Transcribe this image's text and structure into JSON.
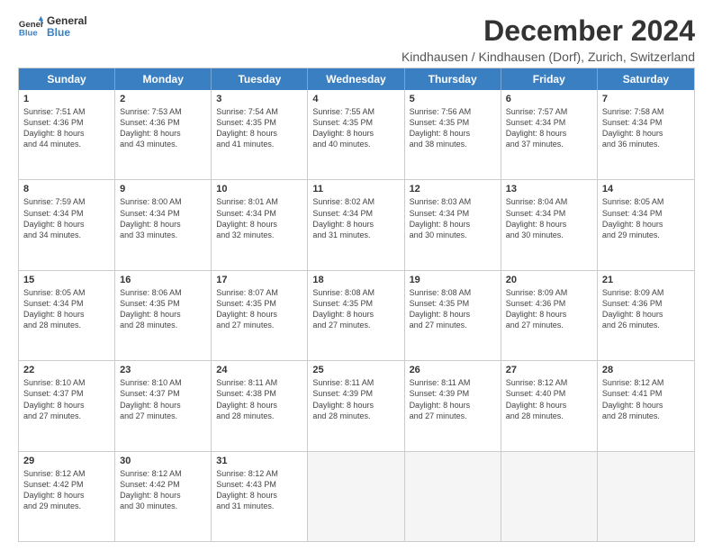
{
  "logo": {
    "line1": "General",
    "line2": "Blue"
  },
  "title": "December 2024",
  "subtitle": "Kindhausen / Kindhausen (Dorf), Zurich, Switzerland",
  "days_of_week": [
    "Sunday",
    "Monday",
    "Tuesday",
    "Wednesday",
    "Thursday",
    "Friday",
    "Saturday"
  ],
  "weeks": [
    [
      {
        "day": "1",
        "lines": [
          "Sunrise: 7:51 AM",
          "Sunset: 4:36 PM",
          "Daylight: 8 hours",
          "and 44 minutes."
        ]
      },
      {
        "day": "2",
        "lines": [
          "Sunrise: 7:53 AM",
          "Sunset: 4:36 PM",
          "Daylight: 8 hours",
          "and 43 minutes."
        ]
      },
      {
        "day": "3",
        "lines": [
          "Sunrise: 7:54 AM",
          "Sunset: 4:35 PM",
          "Daylight: 8 hours",
          "and 41 minutes."
        ]
      },
      {
        "day": "4",
        "lines": [
          "Sunrise: 7:55 AM",
          "Sunset: 4:35 PM",
          "Daylight: 8 hours",
          "and 40 minutes."
        ]
      },
      {
        "day": "5",
        "lines": [
          "Sunrise: 7:56 AM",
          "Sunset: 4:35 PM",
          "Daylight: 8 hours",
          "and 38 minutes."
        ]
      },
      {
        "day": "6",
        "lines": [
          "Sunrise: 7:57 AM",
          "Sunset: 4:34 PM",
          "Daylight: 8 hours",
          "and 37 minutes."
        ]
      },
      {
        "day": "7",
        "lines": [
          "Sunrise: 7:58 AM",
          "Sunset: 4:34 PM",
          "Daylight: 8 hours",
          "and 36 minutes."
        ]
      }
    ],
    [
      {
        "day": "8",
        "lines": [
          "Sunrise: 7:59 AM",
          "Sunset: 4:34 PM",
          "Daylight: 8 hours",
          "and 34 minutes."
        ]
      },
      {
        "day": "9",
        "lines": [
          "Sunrise: 8:00 AM",
          "Sunset: 4:34 PM",
          "Daylight: 8 hours",
          "and 33 minutes."
        ]
      },
      {
        "day": "10",
        "lines": [
          "Sunrise: 8:01 AM",
          "Sunset: 4:34 PM",
          "Daylight: 8 hours",
          "and 32 minutes."
        ]
      },
      {
        "day": "11",
        "lines": [
          "Sunrise: 8:02 AM",
          "Sunset: 4:34 PM",
          "Daylight: 8 hours",
          "and 31 minutes."
        ]
      },
      {
        "day": "12",
        "lines": [
          "Sunrise: 8:03 AM",
          "Sunset: 4:34 PM",
          "Daylight: 8 hours",
          "and 30 minutes."
        ]
      },
      {
        "day": "13",
        "lines": [
          "Sunrise: 8:04 AM",
          "Sunset: 4:34 PM",
          "Daylight: 8 hours",
          "and 30 minutes."
        ]
      },
      {
        "day": "14",
        "lines": [
          "Sunrise: 8:05 AM",
          "Sunset: 4:34 PM",
          "Daylight: 8 hours",
          "and 29 minutes."
        ]
      }
    ],
    [
      {
        "day": "15",
        "lines": [
          "Sunrise: 8:05 AM",
          "Sunset: 4:34 PM",
          "Daylight: 8 hours",
          "and 28 minutes."
        ]
      },
      {
        "day": "16",
        "lines": [
          "Sunrise: 8:06 AM",
          "Sunset: 4:35 PM",
          "Daylight: 8 hours",
          "and 28 minutes."
        ]
      },
      {
        "day": "17",
        "lines": [
          "Sunrise: 8:07 AM",
          "Sunset: 4:35 PM",
          "Daylight: 8 hours",
          "and 27 minutes."
        ]
      },
      {
        "day": "18",
        "lines": [
          "Sunrise: 8:08 AM",
          "Sunset: 4:35 PM",
          "Daylight: 8 hours",
          "and 27 minutes."
        ]
      },
      {
        "day": "19",
        "lines": [
          "Sunrise: 8:08 AM",
          "Sunset: 4:35 PM",
          "Daylight: 8 hours",
          "and 27 minutes."
        ]
      },
      {
        "day": "20",
        "lines": [
          "Sunrise: 8:09 AM",
          "Sunset: 4:36 PM",
          "Daylight: 8 hours",
          "and 27 minutes."
        ]
      },
      {
        "day": "21",
        "lines": [
          "Sunrise: 8:09 AM",
          "Sunset: 4:36 PM",
          "Daylight: 8 hours",
          "and 26 minutes."
        ]
      }
    ],
    [
      {
        "day": "22",
        "lines": [
          "Sunrise: 8:10 AM",
          "Sunset: 4:37 PM",
          "Daylight: 8 hours",
          "and 27 minutes."
        ]
      },
      {
        "day": "23",
        "lines": [
          "Sunrise: 8:10 AM",
          "Sunset: 4:37 PM",
          "Daylight: 8 hours",
          "and 27 minutes."
        ]
      },
      {
        "day": "24",
        "lines": [
          "Sunrise: 8:11 AM",
          "Sunset: 4:38 PM",
          "Daylight: 8 hours",
          "and 28 minutes."
        ]
      },
      {
        "day": "25",
        "lines": [
          "Sunrise: 8:11 AM",
          "Sunset: 4:39 PM",
          "Daylight: 8 hours",
          "and 28 minutes."
        ]
      },
      {
        "day": "26",
        "lines": [
          "Sunrise: 8:11 AM",
          "Sunset: 4:39 PM",
          "Daylight: 8 hours",
          "and 27 minutes."
        ]
      },
      {
        "day": "27",
        "lines": [
          "Sunrise: 8:12 AM",
          "Sunset: 4:40 PM",
          "Daylight: 8 hours",
          "and 28 minutes."
        ]
      },
      {
        "day": "28",
        "lines": [
          "Sunrise: 8:12 AM",
          "Sunset: 4:41 PM",
          "Daylight: 8 hours",
          "and 28 minutes."
        ]
      }
    ],
    [
      {
        "day": "29",
        "lines": [
          "Sunrise: 8:12 AM",
          "Sunset: 4:42 PM",
          "Daylight: 8 hours",
          "and 29 minutes."
        ]
      },
      {
        "day": "30",
        "lines": [
          "Sunrise: 8:12 AM",
          "Sunset: 4:42 PM",
          "Daylight: 8 hours",
          "and 30 minutes."
        ]
      },
      {
        "day": "31",
        "lines": [
          "Sunrise: 8:12 AM",
          "Sunset: 4:43 PM",
          "Daylight: 8 hours",
          "and 31 minutes."
        ]
      },
      {
        "day": "",
        "lines": []
      },
      {
        "day": "",
        "lines": []
      },
      {
        "day": "",
        "lines": []
      },
      {
        "day": "",
        "lines": []
      }
    ]
  ]
}
